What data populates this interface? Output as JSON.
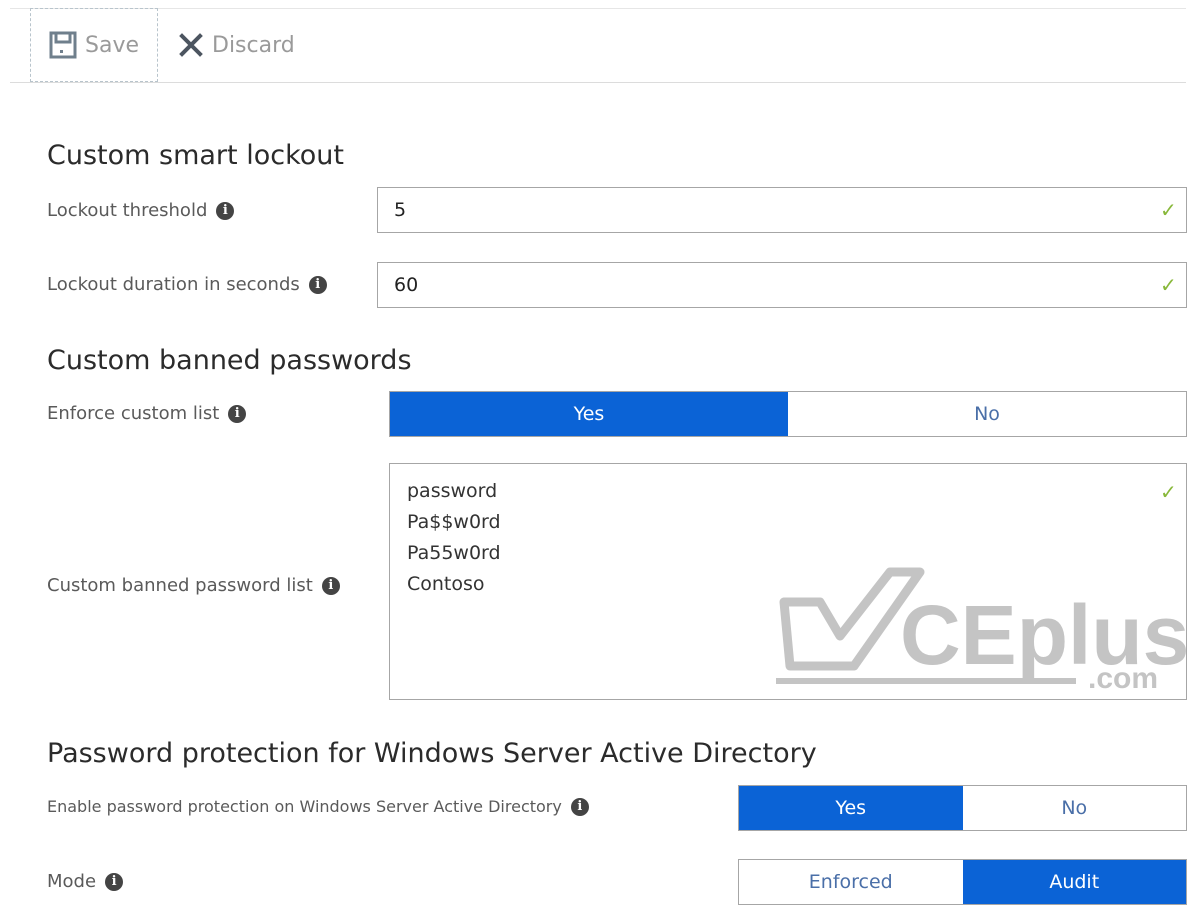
{
  "toolbar": {
    "save_label": "Save",
    "discard_label": "Discard"
  },
  "lockout": {
    "title": "Custom smart lockout",
    "threshold_label": "Lockout threshold",
    "threshold_value": "5",
    "duration_label": "Lockout duration in seconds",
    "duration_value": "60"
  },
  "banned": {
    "title": "Custom banned passwords",
    "enforce_label": "Enforce custom list",
    "enforce_yes": "Yes",
    "enforce_no": "No",
    "enforce_selected": "Yes",
    "list_label": "Custom banned password list",
    "list": [
      "password",
      "Pa$$w0rd",
      "Pa55w0rd",
      "Contoso"
    ]
  },
  "ad": {
    "title": "Password protection for Windows Server Active Directory",
    "enable_label": "Enable password protection on Windows Server Active Directory",
    "enable_yes": "Yes",
    "enable_no": "No",
    "enable_selected": "Yes",
    "mode_label": "Mode",
    "mode_enforced": "Enforced",
    "mode_audit": "Audit",
    "mode_selected": "Audit"
  },
  "watermark": {
    "brand": "CEplus",
    "suffix": ".com"
  },
  "colors": {
    "accent": "#0b63d6",
    "valid": "#88b83a"
  }
}
